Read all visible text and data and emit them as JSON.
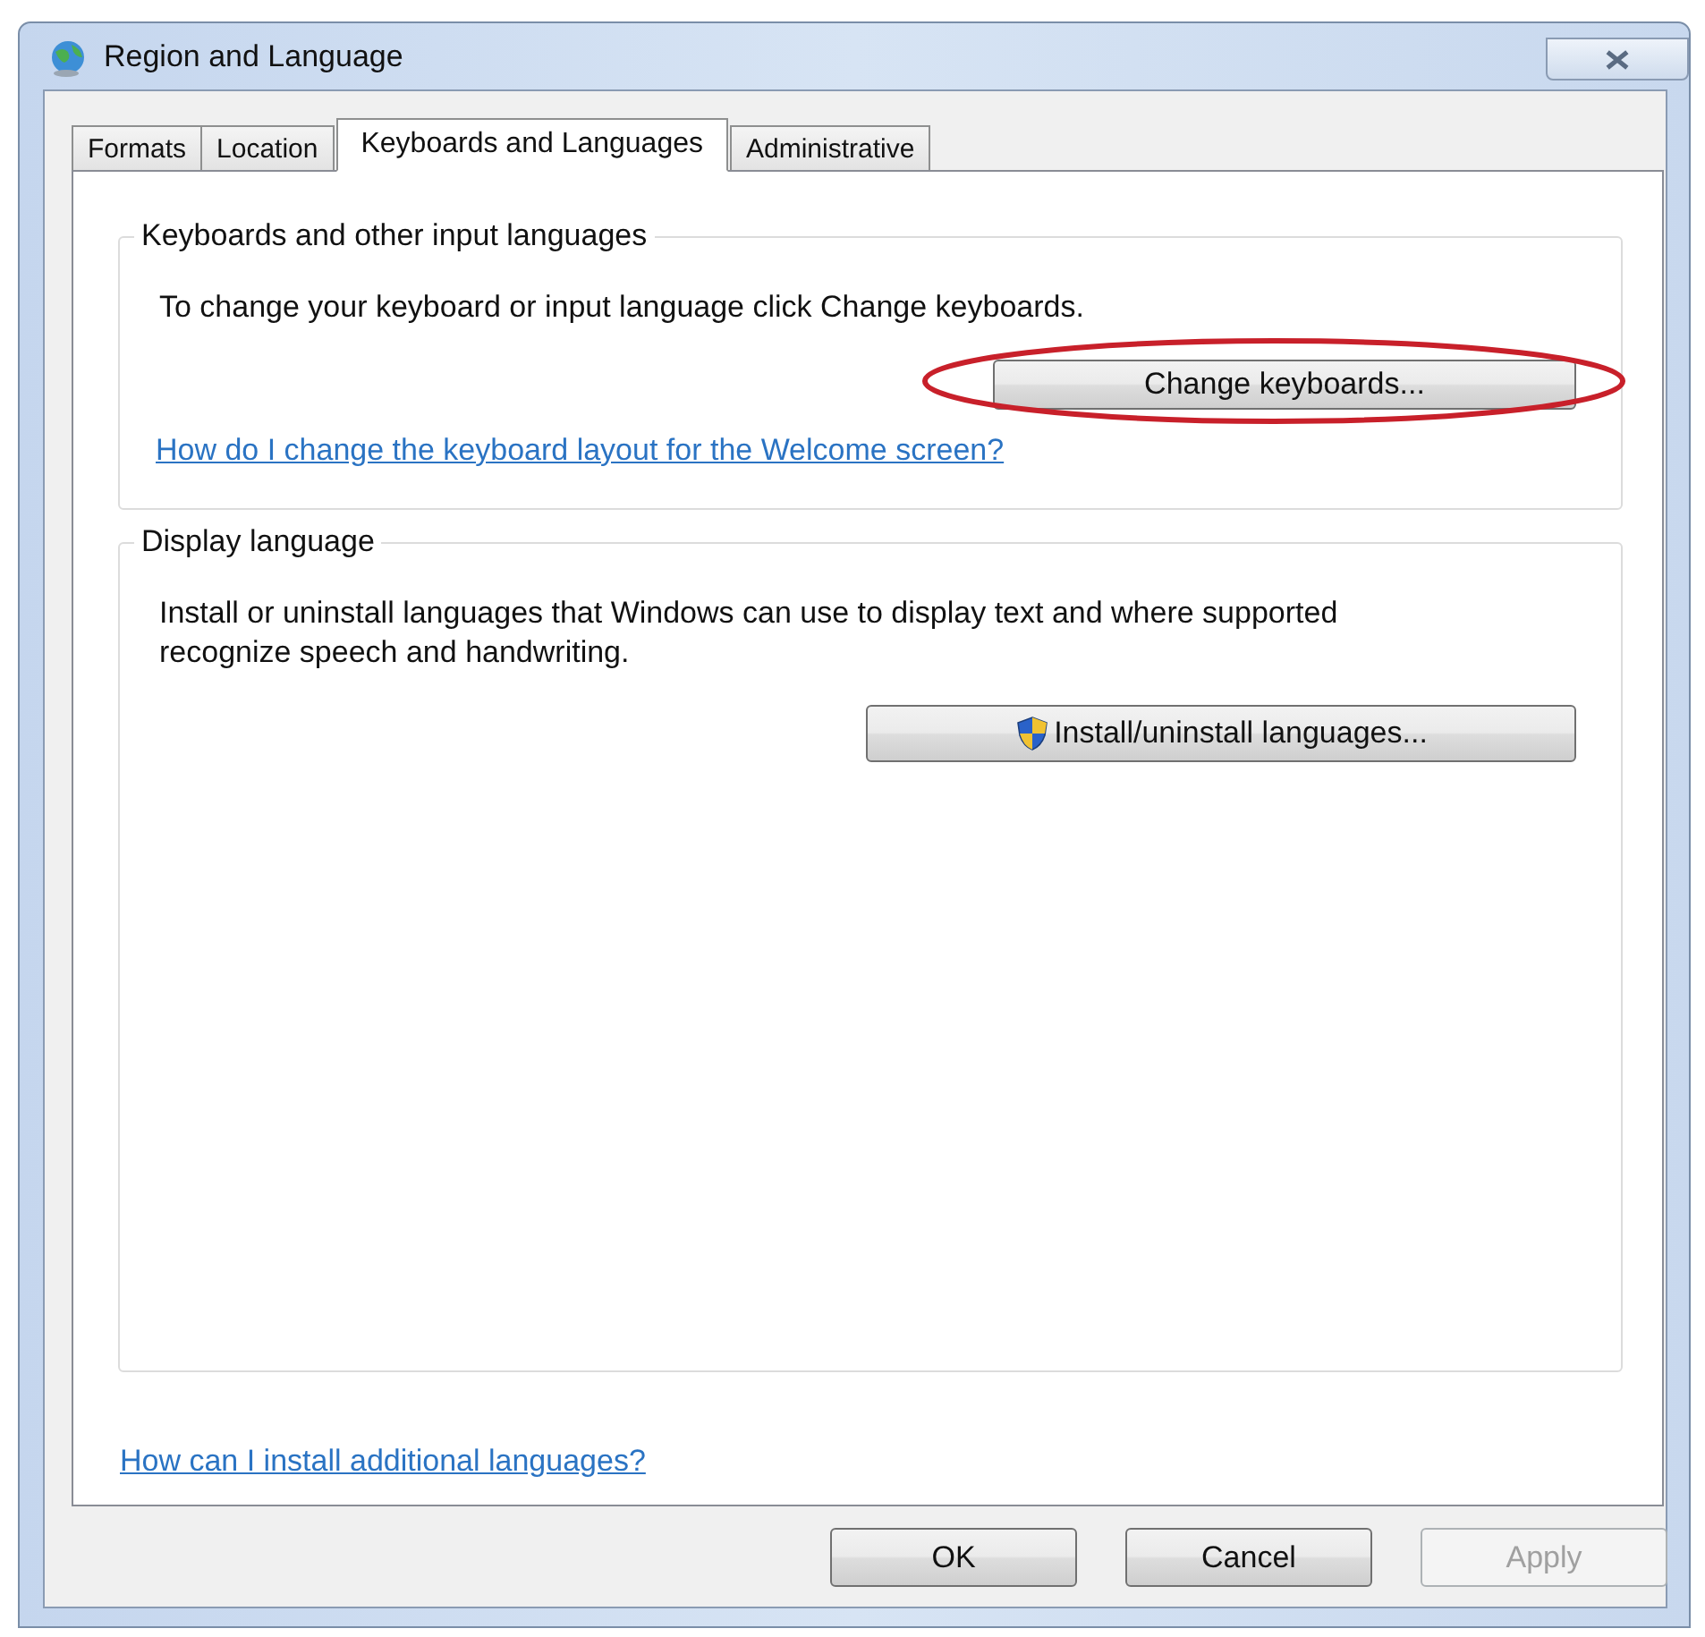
{
  "window": {
    "title": "Region and Language"
  },
  "tabs": [
    {
      "label": "Formats",
      "selected": false
    },
    {
      "label": "Location",
      "selected": false
    },
    {
      "label": "Keyboards and Languages",
      "selected": true
    },
    {
      "label": "Administrative",
      "selected": false
    }
  ],
  "groups": [
    {
      "legend": "Keyboards and other input languages",
      "text": "To change your keyboard or input language click Change keyboards.",
      "button": {
        "label": "Change keyboards...",
        "shield": false,
        "highlighted": true
      },
      "link": "How do I change the keyboard layout for the Welcome screen?"
    },
    {
      "legend": "Display language",
      "text": "Install or uninstall languages that Windows can use to display text and where supported recognize speech and handwriting.",
      "button": {
        "label": "Install/uninstall languages...",
        "shield": true,
        "highlighted": false
      }
    }
  ],
  "link": "How can I install additional languages?",
  "buttons": [
    {
      "label": "OK",
      "disabled": false
    },
    {
      "label": "Cancel",
      "disabled": false
    },
    {
      "label": "Apply",
      "disabled": true
    }
  ]
}
